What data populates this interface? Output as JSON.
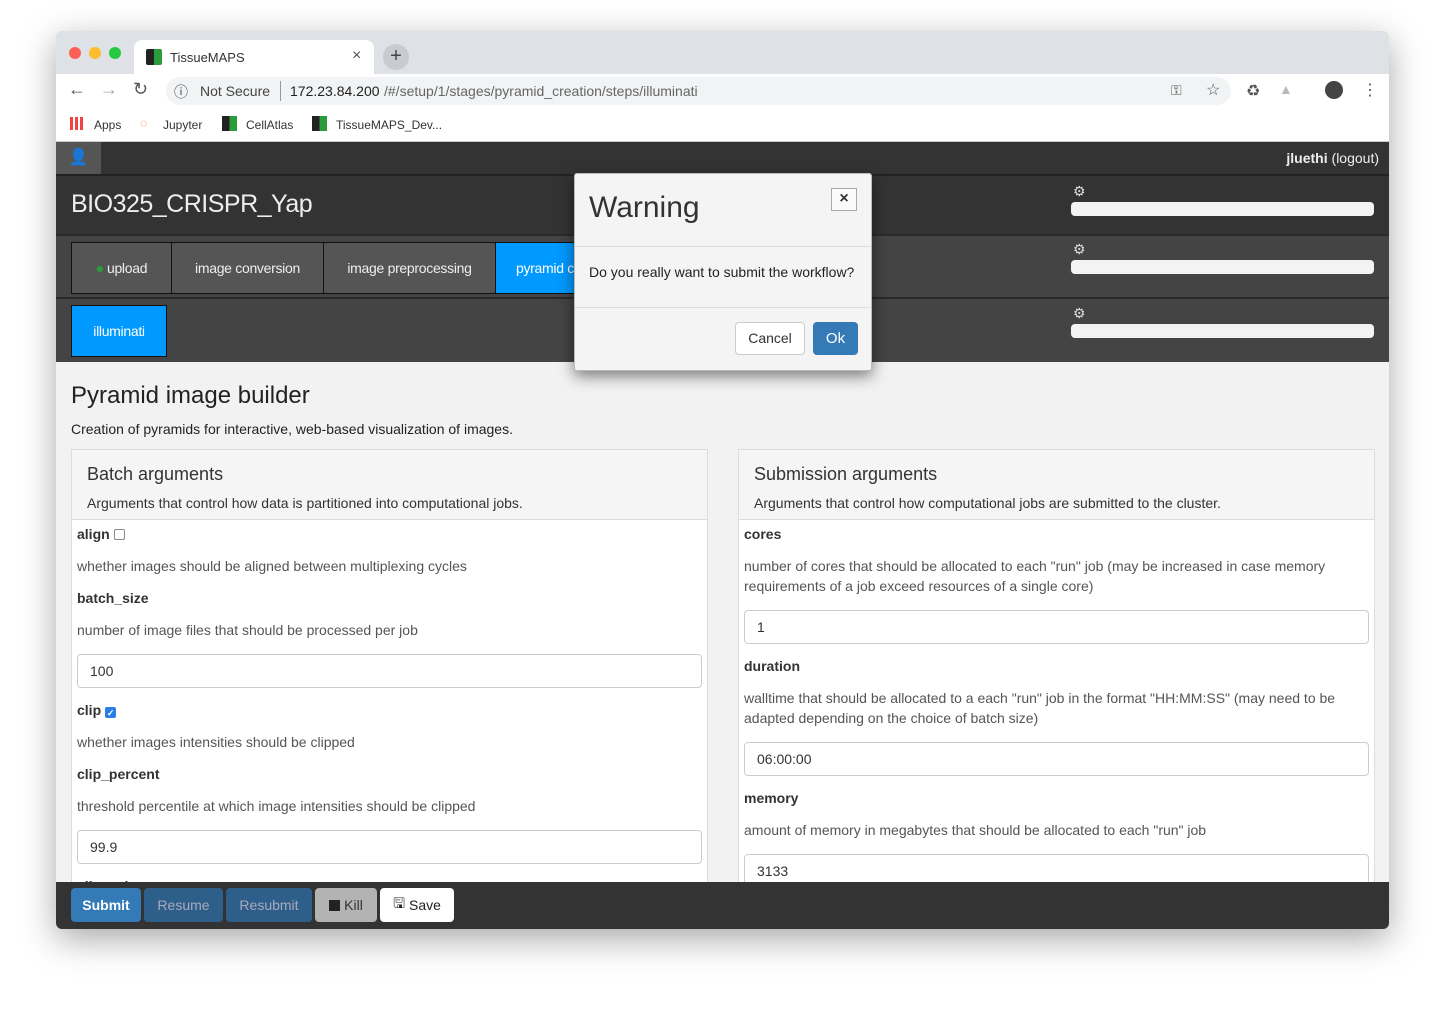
{
  "browser": {
    "tab_title": "TissueMAPS",
    "security": "Not Secure",
    "url_host": "172.23.84.200",
    "url_path": "/#/setup/1/stages/pyramid_creation/steps/illuminati",
    "bookmarks": [
      "Apps",
      "Jupyter",
      "CellAtlas",
      "TissueMAPS_Dev..."
    ]
  },
  "nav": {
    "user": "jluethi",
    "logout": "(logout)"
  },
  "experiment_title": "BIO325_CRISPR_Yap",
  "stages": [
    {
      "label": "upload",
      "done": true
    },
    {
      "label": "image conversion"
    },
    {
      "label": "image preprocessing"
    },
    {
      "label": "pyramid c",
      "active": true
    }
  ],
  "steps": [
    {
      "label": "illuminati",
      "active": true
    }
  ],
  "progress": [
    0,
    0,
    0
  ],
  "page": {
    "title": "Pyramid image builder",
    "description": "Creation of pyramids for interactive, web-based visualization of images."
  },
  "batch": {
    "title": "Batch arguments",
    "description": "Arguments that control how data is partitioned into computational jobs.",
    "args": [
      {
        "name": "align",
        "type": "checkbox",
        "checked": false,
        "help": "whether images should be aligned between multiplexing cycles"
      },
      {
        "name": "batch_size",
        "help": "number of image files that should be processed per job",
        "value": "100"
      },
      {
        "name": "clip",
        "type": "checkbox",
        "checked": true,
        "help": "whether images intensities should be clipped"
      },
      {
        "name": "clip_percent",
        "help": "threshold percentile at which image intensities should be clipped",
        "value": "99.9"
      },
      {
        "name": "clip_value"
      }
    ]
  },
  "submission": {
    "title": "Submission arguments",
    "description": "Arguments that control how computational jobs are submitted to the cluster.",
    "args": [
      {
        "name": "cores",
        "help": "number of cores that should be allocated to each \"run\" job (may be increased in case memory requirements of a job exceed resources of a single core)",
        "value": "1"
      },
      {
        "name": "duration",
        "help": "walltime that should be allocated to a each \"run\" job in the format \"HH:MM:SS\" (may need to be adapted depending on the choice of batch size)",
        "value": "06:00:00"
      },
      {
        "name": "memory",
        "help": "amount of memory in megabytes that should be allocated to each \"run\" job",
        "value": "3133"
      }
    ]
  },
  "footer": {
    "submit": "Submit",
    "resume": "Resume",
    "resubmit": "Resubmit",
    "kill": "Kill",
    "save": "Save"
  },
  "modal": {
    "title": "Warning",
    "message": "Do you really want to submit the workflow?",
    "cancel": "Cancel",
    "ok": "Ok",
    "close": "×"
  },
  "colors": {
    "accent": "#0099ff",
    "primary": "#337ab7"
  }
}
